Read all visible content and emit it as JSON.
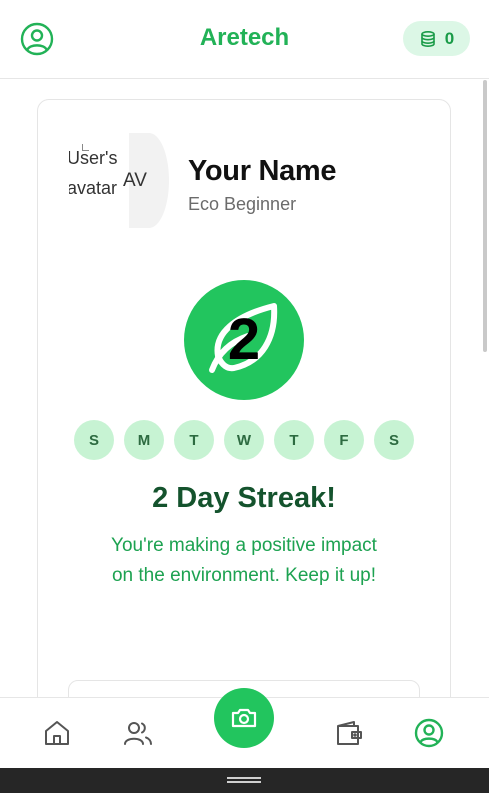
{
  "header": {
    "title": "Aretech",
    "coins": "0"
  },
  "profile": {
    "avatar_alt": "User's avatar",
    "avatar_fallback": "AV",
    "name": "Your Name",
    "level": "Eco Beginner"
  },
  "streak": {
    "count": "2",
    "days": [
      "S",
      "M",
      "T",
      "W",
      "T",
      "F",
      "S"
    ],
    "title": "2 Day Streak!",
    "message": "You're making a positive impact on the environment. Keep it up!"
  },
  "colors": {
    "accent": "#22c55e",
    "accent_dark": "#14532d",
    "day_bg": "#c7f3d3"
  },
  "icons": {
    "profile": "user-circle-icon",
    "coins": "coins-stack-icon",
    "leaf": "leaf-icon",
    "home": "home-icon",
    "community": "users-icon",
    "camera": "camera-icon",
    "wallet": "wallet-icon",
    "account": "user-circle-icon"
  }
}
